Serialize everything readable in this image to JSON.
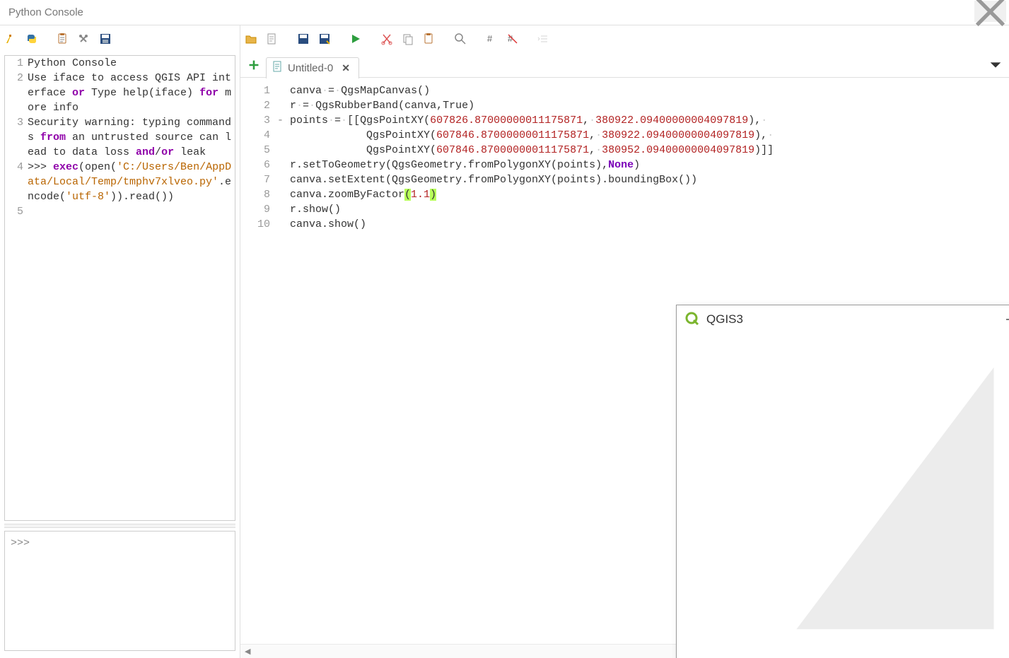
{
  "window": {
    "title": "Python Console"
  },
  "left_toolbar": {
    "icons": [
      "clear-icon",
      "python-icon",
      "paste-icon",
      "settings-icon",
      "save-icon"
    ]
  },
  "right_toolbar": {
    "icons": [
      "open-file-icon",
      "new-file-icon",
      "save-icon",
      "save-as-icon",
      "run-icon",
      "cut-icon",
      "copy-icon",
      "paste-icon",
      "search-icon",
      "comment-icon",
      "uncomment-icon",
      "outdent-icon"
    ]
  },
  "tabs": {
    "add_label": "+",
    "active": {
      "label": "Untitled-0"
    }
  },
  "console": {
    "lines": [
      {
        "n": "1",
        "seg": [
          {
            "t": "Python Console"
          }
        ]
      },
      {
        "n": "2",
        "seg": [
          {
            "t": "Use iface to access QGIS API interface "
          },
          {
            "t": "or",
            "c": "kw"
          },
          {
            "t": " Type help(iface) "
          },
          {
            "t": "for",
            "c": "kw"
          },
          {
            "t": " more info"
          }
        ]
      },
      {
        "n": "3",
        "seg": [
          {
            "t": "Security warning: typing commands "
          },
          {
            "t": "from",
            "c": "kw"
          },
          {
            "t": " an untrusted source can lead to data loss "
          },
          {
            "t": "and",
            "c": "kw"
          },
          {
            "t": "/"
          },
          {
            "t": "or",
            "c": "kw"
          },
          {
            "t": " leak"
          }
        ]
      },
      {
        "n": "4",
        "seg": [
          {
            "t": ">>> "
          },
          {
            "t": "exec",
            "c": "kw"
          },
          {
            "t": "(open("
          },
          {
            "t": "'C:/Users/Ben/AppData/Local/Temp/tmphv7xlveo.py'",
            "c": "st"
          },
          {
            "t": ".encode("
          },
          {
            "t": "'utf-8'",
            "c": "st"
          },
          {
            "t": ")).read())"
          }
        ]
      },
      {
        "n": "5",
        "seg": [
          {
            "t": ""
          }
        ]
      }
    ],
    "prompt": ">>> "
  },
  "editor": {
    "lines": [
      {
        "n": "1",
        "fold": "",
        "seg": [
          {
            "t": "canva"
          },
          {
            "t": "·",
            "c": "ws-dot"
          },
          {
            "t": "="
          },
          {
            "t": "·",
            "c": "ws-dot"
          },
          {
            "t": "QgsMapCanvas()"
          }
        ]
      },
      {
        "n": "2",
        "fold": "",
        "seg": [
          {
            "t": "r"
          },
          {
            "t": "·",
            "c": "ws-dot"
          },
          {
            "t": "="
          },
          {
            "t": "·",
            "c": "ws-dot"
          },
          {
            "t": "QgsRubberBand(canva,True)"
          }
        ]
      },
      {
        "n": "3",
        "fold": "-",
        "seg": [
          {
            "t": "points"
          },
          {
            "t": "·",
            "c": "ws-dot"
          },
          {
            "t": "="
          },
          {
            "t": "·",
            "c": "ws-dot"
          },
          {
            "t": "[[QgsPointXY("
          },
          {
            "t": "607826.87000000011175871",
            "c": "num"
          },
          {
            "t": ","
          },
          {
            "t": "·",
            "c": "ws-dot"
          },
          {
            "t": "380922.09400000004097819",
            "c": "num"
          },
          {
            "t": "),"
          },
          {
            "t": "·",
            "c": "ws-dot"
          }
        ]
      },
      {
        "n": "4",
        "fold": "",
        "seg": [
          {
            "t": "            QgsPointXY("
          },
          {
            "t": "607846.87000000011175871",
            "c": "num"
          },
          {
            "t": ","
          },
          {
            "t": "·",
            "c": "ws-dot"
          },
          {
            "t": "380922.09400000004097819",
            "c": "num"
          },
          {
            "t": "),"
          },
          {
            "t": "·",
            "c": "ws-dot"
          }
        ]
      },
      {
        "n": "5",
        "fold": "",
        "seg": [
          {
            "t": "            QgsPointXY("
          },
          {
            "t": "607846.87000000011175871",
            "c": "num"
          },
          {
            "t": ","
          },
          {
            "t": "·",
            "c": "ws-dot"
          },
          {
            "t": "380952.09400000004097819",
            "c": "num"
          },
          {
            "t": ")]]"
          }
        ]
      },
      {
        "n": "6",
        "fold": "",
        "seg": [
          {
            "t": "r.setToGeometry(QgsGeometry.fromPolygonXY(points),"
          },
          {
            "t": "None",
            "c": "func"
          },
          {
            "t": ")"
          }
        ]
      },
      {
        "n": "7",
        "fold": "",
        "seg": [
          {
            "t": "canva.setExtent(QgsGeometry.fromPolygonXY(points).boundingBox())"
          }
        ]
      },
      {
        "n": "8",
        "fold": "",
        "seg": [
          {
            "t": "canva.zoomByFactor"
          },
          {
            "t": "(",
            "c": "hl-paren"
          },
          {
            "t": "1.1",
            "c": "num"
          },
          {
            "t": ")",
            "c": "hl-paren"
          }
        ]
      },
      {
        "n": "9",
        "fold": "",
        "seg": [
          {
            "t": "r.show()"
          }
        ]
      },
      {
        "n": "10",
        "fold": "",
        "seg": [
          {
            "t": "canva.show()"
          }
        ]
      }
    ]
  },
  "child_window": {
    "title": "QGIS3"
  }
}
